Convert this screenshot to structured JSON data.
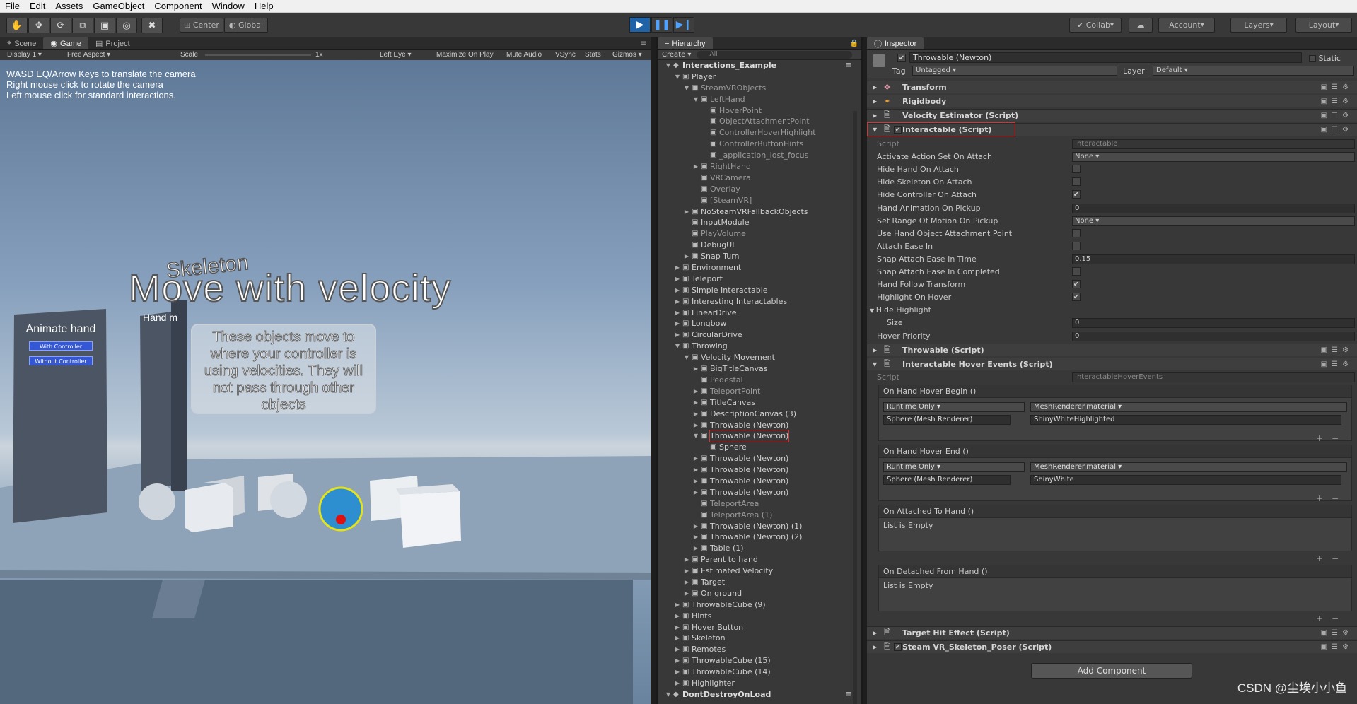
{
  "menu": [
    "File",
    "Edit",
    "Assets",
    "GameObject",
    "Component",
    "Window",
    "Help"
  ],
  "toolbar": {
    "pivot_label": "Center",
    "space_label": "Global",
    "collab_label": "Collab",
    "account_label": "Account",
    "layers_label": "Layers",
    "layout_label": "Layout"
  },
  "left_tabs": {
    "scene": "Scene",
    "game": "Game",
    "project": "Project"
  },
  "game_bar": {
    "display": "Display 1",
    "aspect": "Free Aspect",
    "scale_label": "Scale",
    "scale_value": "1x",
    "eye": "Left Eye",
    "maximize": "Maximize On Play",
    "mute": "Mute Audio",
    "vsync": "VSync",
    "stats": "Stats",
    "gizmos": "Gizmos"
  },
  "game": {
    "hints": [
      "WASD EQ/Arrow Keys to translate the camera",
      "Right mouse click to rotate the camera",
      "Left mouse click for standard interactions."
    ],
    "skeleton_text": "Skeleton",
    "big_title": "Move with velocity",
    "description": "These objects move to where your controller is using velocities. They will not pass through other objects",
    "board_title": "Animate hand",
    "board_btn1": "With Controller",
    "board_btn2": "Without Controller",
    "board2_title": "Hand m"
  },
  "hierarchy": {
    "tab": "Hierarchy",
    "create": "Create",
    "search": "All",
    "rows": [
      {
        "text": "Interactions_Example",
        "level": 0,
        "arrow": "down",
        "type": "scene"
      },
      {
        "text": "Player",
        "level": 1,
        "arrow": "down"
      },
      {
        "text": "SteamVRObjects",
        "level": 2,
        "arrow": "down",
        "dim": true
      },
      {
        "text": "LeftHand",
        "level": 3,
        "arrow": "down",
        "dim": true
      },
      {
        "text": "HoverPoint",
        "level": 4,
        "dim": true
      },
      {
        "text": "ObjectAttachmentPoint",
        "level": 4,
        "dim": true
      },
      {
        "text": "ControllerHoverHighlight",
        "level": 4,
        "dim": true
      },
      {
        "text": "ControllerButtonHints",
        "level": 4,
        "dim": true
      },
      {
        "text": "_application_lost_focus",
        "level": 4,
        "dim": true
      },
      {
        "text": "RightHand",
        "level": 3,
        "arrow": "right",
        "dim": true
      },
      {
        "text": "VRCamera",
        "level": 3,
        "dim": true
      },
      {
        "text": "Overlay",
        "level": 3,
        "dim": true
      },
      {
        "text": "[SteamVR]",
        "level": 3,
        "dim": true
      },
      {
        "text": "NoSteamVRFallbackObjects",
        "level": 2,
        "arrow": "right"
      },
      {
        "text": "InputModule",
        "level": 2
      },
      {
        "text": "PlayVolume",
        "level": 2,
        "dim": true
      },
      {
        "text": "DebugUI",
        "level": 2
      },
      {
        "text": "Snap Turn",
        "level": 2,
        "arrow": "right"
      },
      {
        "text": "Environment",
        "level": 1,
        "arrow": "right"
      },
      {
        "text": "Teleport",
        "level": 1,
        "arrow": "right"
      },
      {
        "text": "Simple Interactable",
        "level": 1,
        "arrow": "right"
      },
      {
        "text": "Interesting Interactables",
        "level": 1,
        "arrow": "right"
      },
      {
        "text": "LinearDrive",
        "level": 1,
        "arrow": "right"
      },
      {
        "text": "Longbow",
        "level": 1,
        "arrow": "right"
      },
      {
        "text": "CircularDrive",
        "level": 1,
        "arrow": "right"
      },
      {
        "text": "Throwing",
        "level": 1,
        "arrow": "down"
      },
      {
        "text": "Velocity Movement",
        "level": 2,
        "arrow": "down"
      },
      {
        "text": "BigTitleCanvas",
        "level": 3,
        "arrow": "right"
      },
      {
        "text": "Pedestal",
        "level": 3,
        "dim": true
      },
      {
        "text": "TeleportPoint",
        "level": 3,
        "arrow": "right",
        "dim": true
      },
      {
        "text": "TitleCanvas",
        "level": 3,
        "arrow": "right"
      },
      {
        "text": "DescriptionCanvas (3)",
        "level": 3,
        "arrow": "right"
      },
      {
        "text": "Throwable (Newton)",
        "level": 3,
        "arrow": "right"
      },
      {
        "text": "Throwable (Newton)",
        "level": 3,
        "arrow": "down",
        "selected": true
      },
      {
        "text": "Sphere",
        "level": 4
      },
      {
        "text": "Throwable (Newton)",
        "level": 3,
        "arrow": "right"
      },
      {
        "text": "Throwable (Newton)",
        "level": 3,
        "arrow": "right"
      },
      {
        "text": "Throwable (Newton)",
        "level": 3,
        "arrow": "right"
      },
      {
        "text": "Throwable (Newton)",
        "level": 3,
        "arrow": "right"
      },
      {
        "text": "TeleportArea",
        "level": 3,
        "dim": true
      },
      {
        "text": "TeleportArea (1)",
        "level": 3,
        "dim": true
      },
      {
        "text": "Throwable (Newton) (1)",
        "level": 3,
        "arrow": "right"
      },
      {
        "text": "Throwable (Newton) (2)",
        "level": 3,
        "arrow": "right"
      },
      {
        "text": "Table (1)",
        "level": 3,
        "arrow": "right"
      },
      {
        "text": "Parent to hand",
        "level": 2,
        "arrow": "right"
      },
      {
        "text": "Estimated Velocity",
        "level": 2,
        "arrow": "right"
      },
      {
        "text": "Target",
        "level": 2,
        "arrow": "right"
      },
      {
        "text": "On ground",
        "level": 2,
        "arrow": "right"
      },
      {
        "text": "ThrowableCube (9)",
        "level": 1,
        "arrow": "right"
      },
      {
        "text": "Hints",
        "level": 1,
        "arrow": "right"
      },
      {
        "text": "Hover Button",
        "level": 1,
        "arrow": "right"
      },
      {
        "text": "Skeleton",
        "level": 1,
        "arrow": "right"
      },
      {
        "text": "Remotes",
        "level": 1,
        "arrow": "right"
      },
      {
        "text": "ThrowableCube (15)",
        "level": 1,
        "arrow": "right"
      },
      {
        "text": "ThrowableCube (14)",
        "level": 1,
        "arrow": "right"
      },
      {
        "text": "Highlighter",
        "level": 1,
        "arrow": "right"
      },
      {
        "text": "DontDestroyOnLoad",
        "level": 0,
        "arrow": "down",
        "type": "scene"
      }
    ]
  },
  "inspector": {
    "tab": "Inspector",
    "object_name": "Throwable (Newton)",
    "static_label": "Static",
    "tag_label": "Tag",
    "tag_value": "Untagged",
    "layer_label": "Layer",
    "layer_value": "Default",
    "components": {
      "transform": "Transform",
      "rigidbody": "Rigidbody",
      "velocity": "Velocity Estimator (Script)",
      "interactable": "Interactable (Script)",
      "throwable": "Throwable (Script)",
      "hover_events": "Interactable Hover Events (Script)",
      "target_hit": "Target Hit Effect (Script)",
      "poser": "Steam VR_Skeleton_Poser (Script)"
    },
    "interactable_props": [
      {
        "label": "Script",
        "value": "Interactable",
        "kind": "obj",
        "dim": true
      },
      {
        "label": "Activate Action Set On Attach",
        "value": "None",
        "kind": "drop"
      },
      {
        "label": "Hide Hand On Attach",
        "value": "",
        "kind": "chk"
      },
      {
        "label": "Hide Skeleton On Attach",
        "value": "",
        "kind": "chk"
      },
      {
        "label": "Hide Controller On Attach",
        "value": "✔",
        "kind": "chk"
      },
      {
        "label": "Hand Animation On Pickup",
        "value": "0",
        "kind": "num"
      },
      {
        "label": "Set Range Of Motion On Pickup",
        "value": "None",
        "kind": "drop"
      },
      {
        "label": "Use Hand Object Attachment Point",
        "value": "",
        "kind": "chk"
      },
      {
        "label": "Attach Ease In",
        "value": "",
        "kind": "chk"
      },
      {
        "label": "Snap Attach Ease In Time",
        "value": "0.15",
        "kind": "num"
      },
      {
        "label": "Snap Attach Ease In Completed",
        "value": "",
        "kind": "chk"
      },
      {
        "label": "Hand Follow Transform",
        "value": "✔",
        "kind": "chk"
      },
      {
        "label": "Highlight On Hover",
        "value": "✔",
        "kind": "chk"
      },
      {
        "label": "Hide Highlight",
        "value": "",
        "kind": "foldout"
      },
      {
        "label": "Size",
        "value": "0",
        "kind": "num",
        "indent": true
      },
      {
        "label": "Hover Priority",
        "value": "0",
        "kind": "num"
      }
    ],
    "hover_script_label": "Script",
    "hover_script_value": "InteractableHoverEvents",
    "events": {
      "begin": "On Hand Hover Begin ()",
      "end": "On Hand Hover End ()",
      "attached": "On Attached To Hand ()",
      "detached": "On Detached From Hand ()",
      "runtime": "Runtime Only",
      "method": "MeshRenderer.material",
      "target_obj": "Sphere (Mesh Renderer)",
      "mat_begin": "ShinyWhiteHighlighted",
      "mat_end": "ShinyWhite",
      "empty": "List is Empty"
    },
    "add_component": "Add Component"
  },
  "watermark": "CSDN @尘埃小小鱼"
}
